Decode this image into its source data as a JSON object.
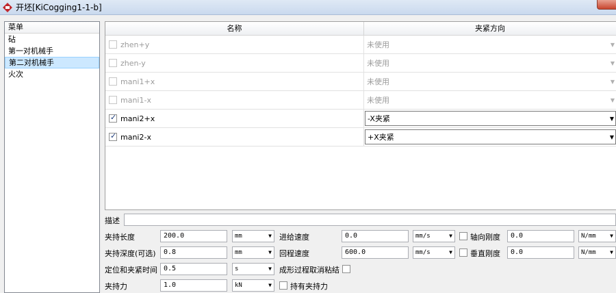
{
  "window": {
    "title": "开坯[KiCogging1-1-b]"
  },
  "menu": {
    "header": "菜单",
    "items": [
      {
        "label": "砧",
        "selected": false
      },
      {
        "label": "第一对机械手",
        "selected": false
      },
      {
        "label": "第二对机械手",
        "selected": true
      },
      {
        "label": "火次",
        "selected": false
      }
    ]
  },
  "grid": {
    "columns": [
      "名称",
      "夹紧方向"
    ],
    "rows": [
      {
        "name": "zhen+y",
        "checked": false,
        "enabled": false,
        "direction": "未使用"
      },
      {
        "name": "zhen-y",
        "checked": false,
        "enabled": false,
        "direction": "未使用"
      },
      {
        "name": "mani1+x",
        "checked": false,
        "enabled": false,
        "direction": "未使用"
      },
      {
        "name": "mani1-x",
        "checked": false,
        "enabled": false,
        "direction": "未使用"
      },
      {
        "name": "mani2+x",
        "checked": true,
        "enabled": true,
        "direction": "-X夹紧"
      },
      {
        "name": "mani2-x",
        "checked": true,
        "enabled": true,
        "direction": "+X夹紧"
      }
    ]
  },
  "form": {
    "description_label": "描述",
    "description_value": "",
    "grip_length": {
      "label": "夹持长度",
      "value": "200.0",
      "unit": "mm"
    },
    "grip_depth": {
      "label": "夹持深度(可选)",
      "value": "0.8",
      "unit": "mm"
    },
    "clamp_time": {
      "label": "定位和夹紧时间",
      "value": "0.5",
      "unit": "s"
    },
    "grip_force": {
      "label": "夹持力",
      "value": "1.0",
      "unit": "kN"
    },
    "feed_speed": {
      "label": "进给速度",
      "value": "0.0",
      "unit": "mm/s"
    },
    "return_speed": {
      "label": "回程速度",
      "value": "600.0",
      "unit": "mm/s"
    },
    "cancel_stick": {
      "label": "成形过程取消粘结",
      "checked": false
    },
    "hold_force": {
      "label": "持有夹持力",
      "checked": false
    },
    "axial_stiffness": {
      "label": "轴向刚度",
      "value": "0.0",
      "unit": "N/mm",
      "checked": false
    },
    "vertical_stiffness": {
      "label": "垂直刚度",
      "value": "0.0",
      "unit": "N/mm",
      "checked": false
    }
  }
}
